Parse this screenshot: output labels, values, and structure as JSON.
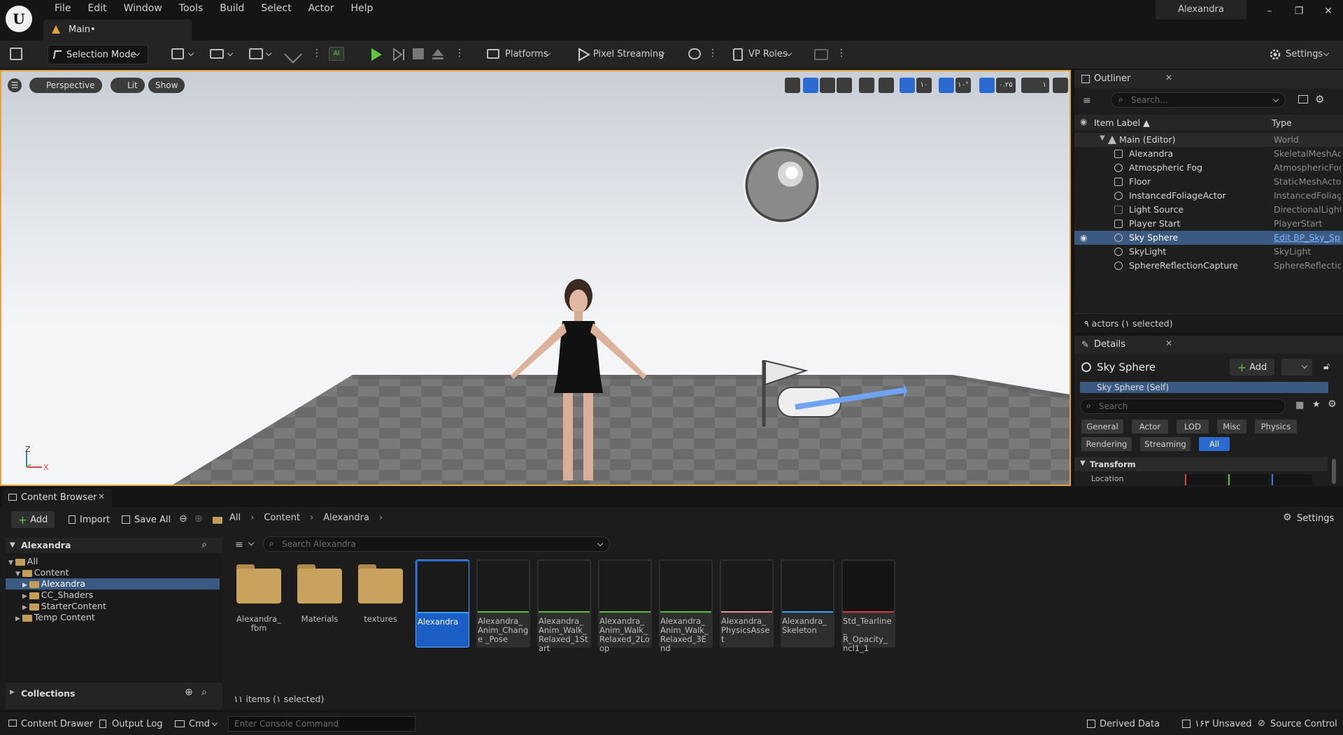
{
  "menu": [
    "File",
    "Edit",
    "Window",
    "Tools",
    "Build",
    "Select",
    "Actor",
    "Help"
  ],
  "window": {
    "project": "Alexandra",
    "minimize": "–",
    "restore": "❐",
    "close": "✕"
  },
  "map_tab": {
    "label": "Main•"
  },
  "toolbar": {
    "selection_mode": "Selection Mode",
    "platforms": "Platforms",
    "pixel_streaming": "Pixel Streaming",
    "vp_roles": "VP Roles",
    "settings": "Settings"
  },
  "viewport": {
    "perspective": "Perspective",
    "lit": "Lit",
    "show": "Show",
    "axis_z": "Z",
    "axis_x": "X",
    "grid_value": "۱۰",
    "rot_value": "۱۰°",
    "scale_value": "۰.۲۵",
    "cam_speed": "۱"
  },
  "outliner": {
    "title": "Outliner",
    "search_placeholder": "Search...",
    "col_label": "Item Label ▲",
    "col_type": "Type",
    "rows": [
      {
        "label": "Main (Editor)",
        "type": "World"
      },
      {
        "label": "Alexandra",
        "type": "SkeletalMeshActor"
      },
      {
        "label": "Atmospheric Fog",
        "type": "AtmosphericFog"
      },
      {
        "label": "Floor",
        "type": "StaticMeshActor"
      },
      {
        "label": "InstancedFoliageActor",
        "type": "InstancedFoliageActor"
      },
      {
        "label": "Light Source",
        "type": "DirectionalLight"
      },
      {
        "label": "Player Start",
        "type": "PlayerStart"
      },
      {
        "label": "Sky Sphere",
        "type": "Edit BP_Sky_Sphere"
      },
      {
        "label": "SkyLight",
        "type": "SkyLight"
      },
      {
        "label": "SphereReflectionCapture",
        "type": "SphereReflectionCapture"
      }
    ],
    "footer": "۹ actors (۱ selected)"
  },
  "details": {
    "title": "Details",
    "object": "Sky Sphere",
    "add": "Add",
    "component": "Sky Sphere (Self)",
    "search_placeholder": "Search",
    "filters1": [
      "General",
      "Actor",
      "LOD",
      "Misc",
      "Physics"
    ],
    "filters2": [
      "Rendering",
      "Streaming",
      "All"
    ],
    "section": "Transform",
    "location": "Location"
  },
  "content_browser": {
    "tab": "Content Browser",
    "add": "Add",
    "import": "Import",
    "save_all": "Save All",
    "breadcrumbs": [
      "All",
      "Content",
      "Alexandra"
    ],
    "settings": "Settings",
    "tree_title": "Alexandra",
    "tree": [
      "All",
      "Content",
      "Alexandra",
      "CC_Shaders",
      "StarterContent",
      "Temp Content"
    ],
    "collections": "Collections",
    "search_placeholder": "Search Alexandra",
    "folders": [
      "Alexandra_ fbm",
      "Materials",
      "textures"
    ],
    "assets": [
      {
        "name": "Alexandra",
        "color": "#3aa0ff"
      },
      {
        "name": "Alexandra_ Anim_Change _Pose",
        "color": "#5dbb3a"
      },
      {
        "name": "Alexandra_ Anim_Walk_ Relaxed_1Start",
        "color": "#5dbb3a"
      },
      {
        "name": "Alexandra_ Anim_Walk_ Relaxed_2Loop",
        "color": "#5dbb3a"
      },
      {
        "name": "Alexandra_ Anim_Walk_ Relaxed_3End",
        "color": "#5dbb3a"
      },
      {
        "name": "Alexandra_ PhysicsAsset",
        "color": "#e89090"
      },
      {
        "name": "Alexandra_ Skeleton",
        "color": "#3aa0ff"
      },
      {
        "name": "Std_Tearline_ R_Opacity_ ncl1_1",
        "color": "#d04040"
      }
    ],
    "status": "۱۱ items (۱ selected)"
  },
  "statusbar": {
    "content_drawer": "Content Drawer",
    "output_log": "Output Log",
    "cmd": "Cmd",
    "console_placeholder": "Enter Console Command",
    "derived_data": "Derived Data",
    "unsaved": "۱۶۳ Unsaved",
    "source_control": "Source Control"
  }
}
